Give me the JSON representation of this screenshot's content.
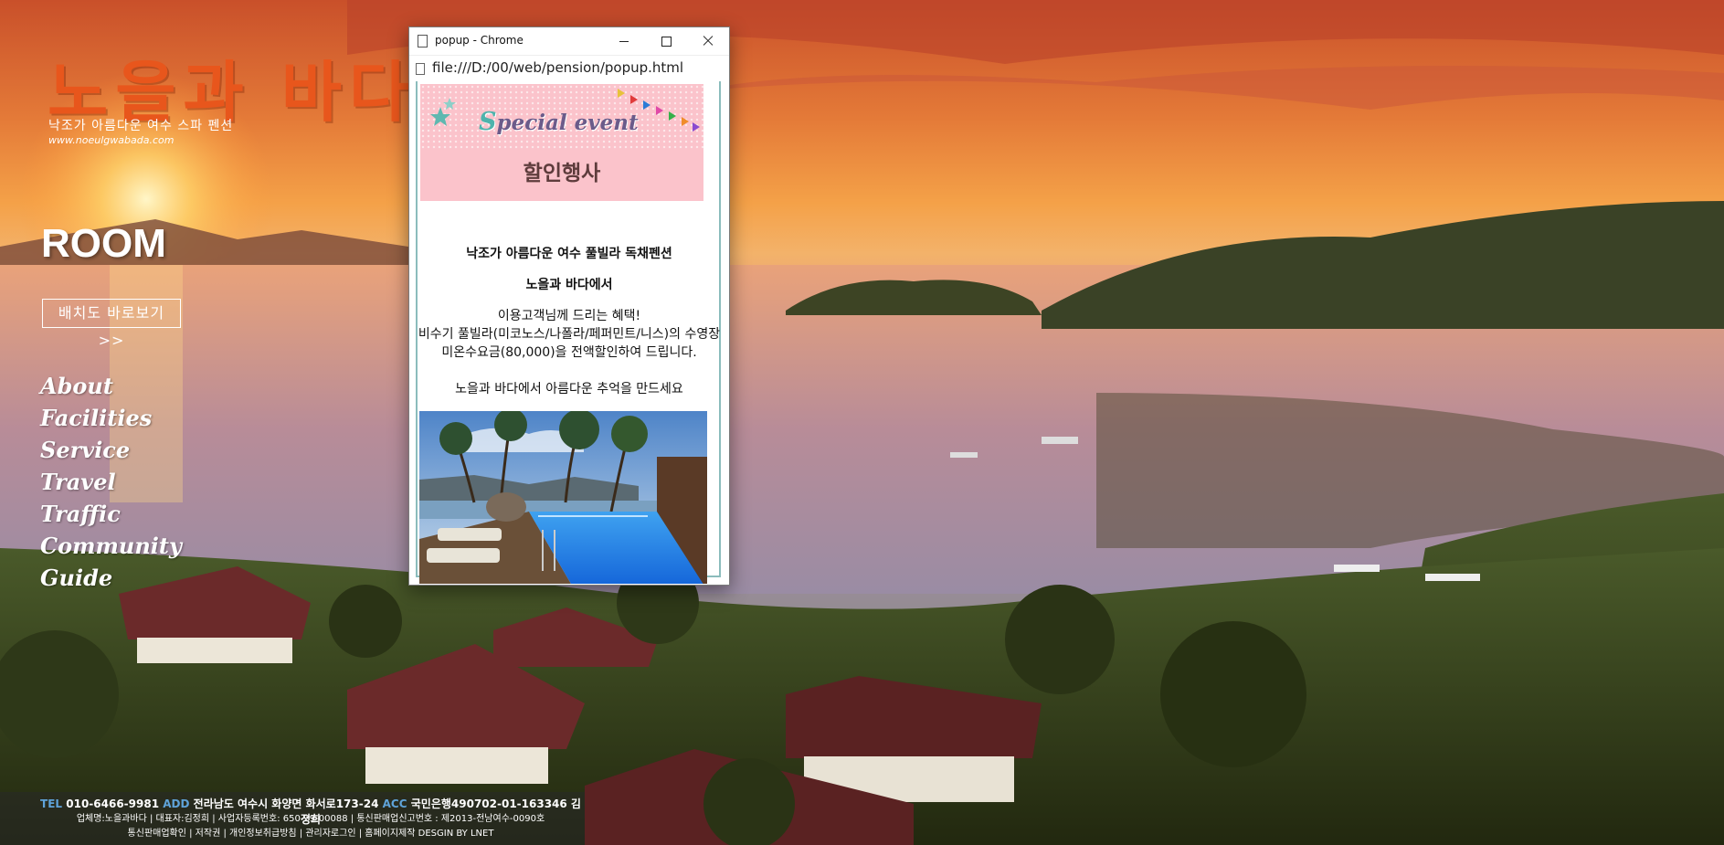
{
  "site": {
    "logo": "노을과 바다",
    "tagline": "낙조가 아름다운 여수 스파 펜션",
    "url": "www.noeulgwabada.com"
  },
  "page": {
    "title": "ROOM",
    "layout_link": "배치도 바로보기 >>"
  },
  "nav": {
    "items": [
      {
        "label": "About"
      },
      {
        "label": "Facilities"
      },
      {
        "label": "Service"
      },
      {
        "label": "Travel"
      },
      {
        "label": "Traffic"
      },
      {
        "label": "Community"
      },
      {
        "label": "Guide"
      }
    ]
  },
  "footer": {
    "tel_label": "TEL",
    "tel": "010-6466-9981",
    "add_label": "ADD",
    "address": "전라남도 여수시 화양면 화서로173-24",
    "acc_label": "ACC",
    "account": "국민은행490702-01-163346 김정희",
    "line2": "업체명:노을과바다 | 대표자:김정희 | 사업자등록번호: 650-29-00088 | 통신판매업신고번호 : 제2013-전남여수-0090호",
    "line3": "통신판매업확인 | 저작권 | 개인정보취급방침 | 관리자로그인 | 홈페이지제작 DESGIN BY LNET"
  },
  "popup": {
    "window_title": "popup - Chrome",
    "url": "file:///D:/00/web/pension/popup.html",
    "banner_special_first": "S",
    "banner_special_rest": "pecial event",
    "banner_title": "할인행사",
    "headline1": "낙조가 아름다운 여수 풀빌라 독채펜션",
    "headline2": "노을과 바다에서",
    "body_line1": "이용고객님께 드리는 혜택!",
    "body_line2": "비수기 풀빌라(미코노스/나폴라/페퍼민트/니스)의 수영장 미온수요금(80,000)을 전액할인하여 드립니다.",
    "body_line3": "노을과 바다에서 아름다운 추억을 만드세요"
  },
  "colors": {
    "logo": "#e8561c",
    "banner_bg": "#fbc3cb",
    "frame_border": "#8bbcbc",
    "footer_key": "#5fa3d9"
  }
}
